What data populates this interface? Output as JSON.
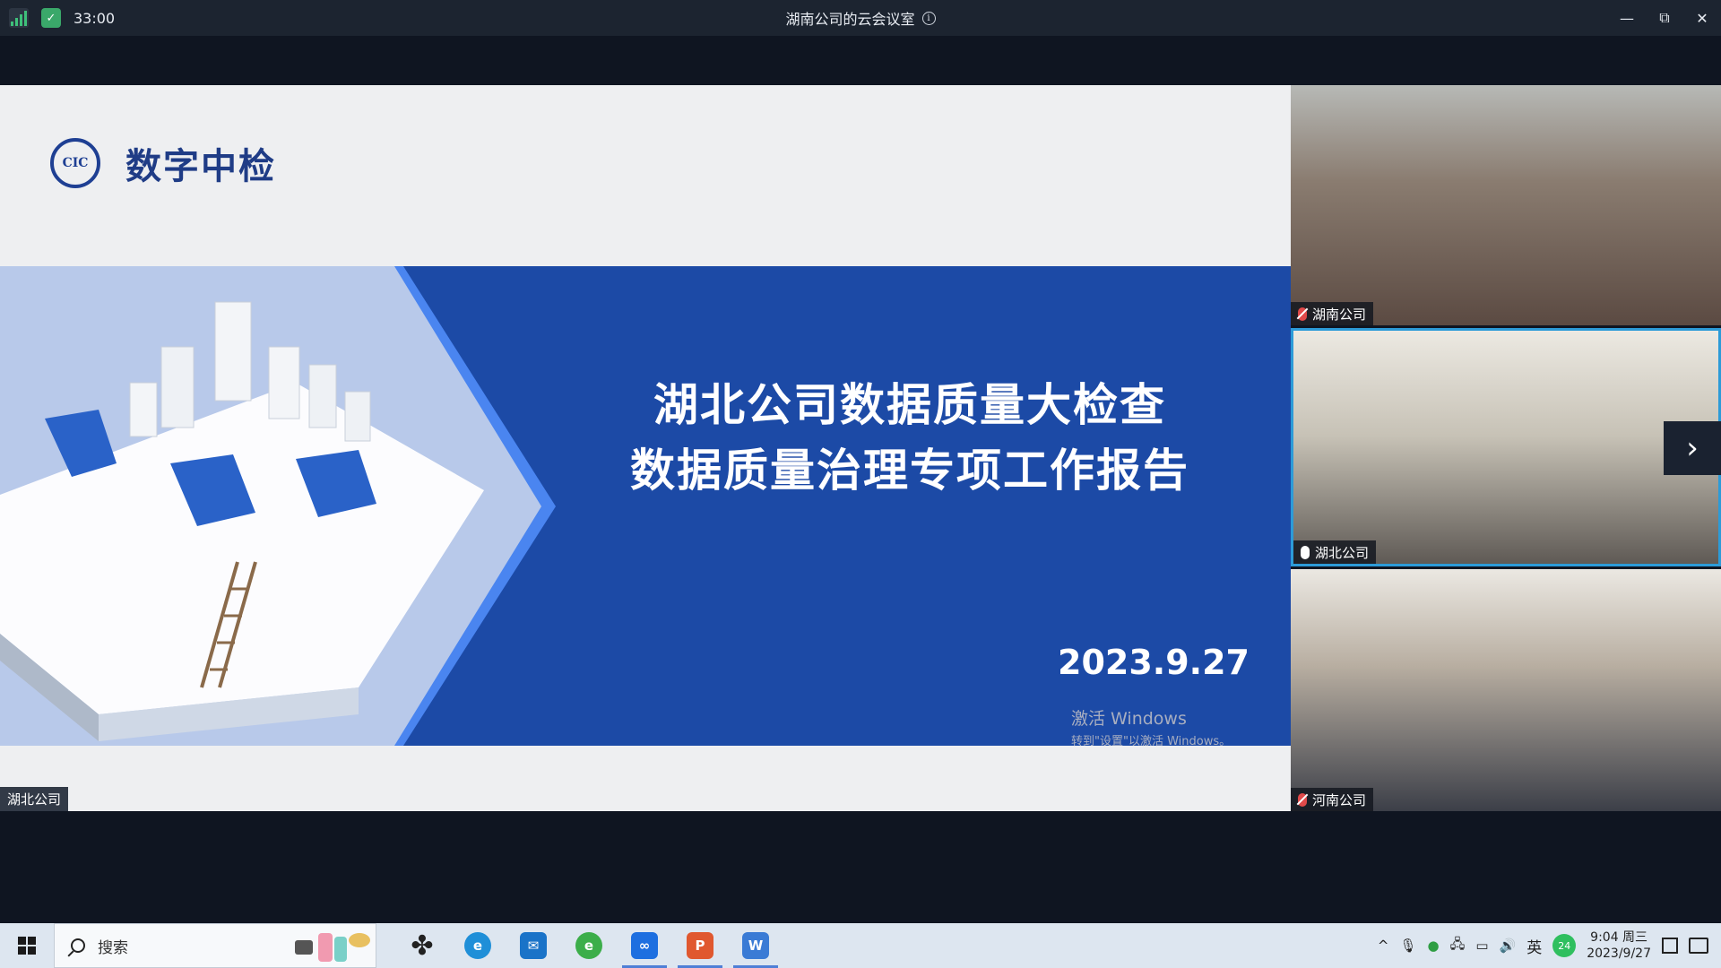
{
  "titlebar": {
    "timer": "33:00",
    "title": "湖南公司的云会议室",
    "info_icon": "i",
    "minimize": "—",
    "restore": "⧉",
    "close": "✕"
  },
  "slide": {
    "brand": "数字中检",
    "logo_text": "CIC",
    "title_line1": "湖北公司数据质量大检查",
    "title_line2": "数据质量治理专项工作报告",
    "date": "2023.9.27",
    "watermark_line1": "激活 Windows",
    "watermark_line2": "转到\"设置\"以激活 Windows。"
  },
  "share_speaker": "湖北公司",
  "video_tiles": [
    {
      "name": "湖南公司",
      "muted": true
    },
    {
      "name": "湖北公司",
      "muted": false
    },
    {
      "name": "河南公司",
      "muted": true
    }
  ],
  "next_arrow": "›",
  "taskbar": {
    "search_text": "搜索",
    "apps": [
      {
        "name": "pinwheel",
        "glyph": "✤",
        "color": "#222222"
      },
      {
        "name": "edge",
        "glyph": "e",
        "color": "#1f8fd8"
      },
      {
        "name": "mail",
        "glyph": "✉",
        "color": "#1a73c8"
      },
      {
        "name": "ie",
        "glyph": "e",
        "color": "#3cae4a"
      },
      {
        "name": "meeting",
        "glyph": "∞",
        "color": "#1d6fe0"
      },
      {
        "name": "powerpoint",
        "glyph": "P",
        "color": "#e0582f"
      },
      {
        "name": "wps",
        "glyph": "W",
        "color": "#3a7bd5"
      }
    ],
    "tray": {
      "caret": "^",
      "ime": "英",
      "badge": "24",
      "time": "9:04 周三",
      "date": "2023/9/27"
    }
  }
}
